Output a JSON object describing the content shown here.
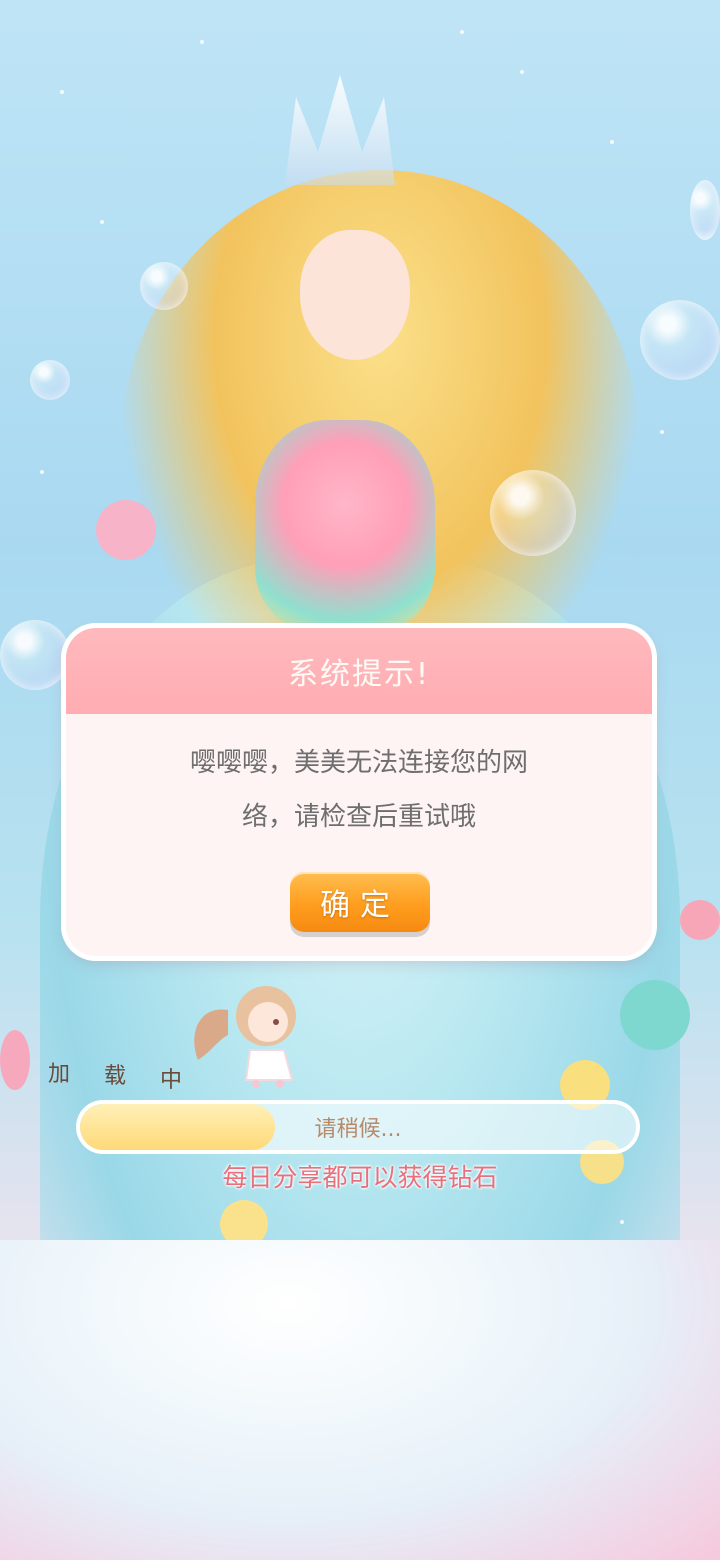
{
  "dialog": {
    "title": "系统提示!",
    "message_line1": "嘤嘤嘤，美美无法连接您的网",
    "message_line2": "络，请检查后重试哦",
    "ok_label": "确定"
  },
  "loading": {
    "label_chars": [
      "加",
      "载",
      "中"
    ],
    "progress_text": "请稍候...",
    "progress_fraction": 0.35,
    "tip": "每日分享都可以获得钻石"
  },
  "colors": {
    "dialog_header": "#ffb2b6",
    "dialog_body": "#fff4f4",
    "button": "#ff9e1e",
    "tip_text": "#e8707d",
    "progress_fill": "#ffd978"
  }
}
